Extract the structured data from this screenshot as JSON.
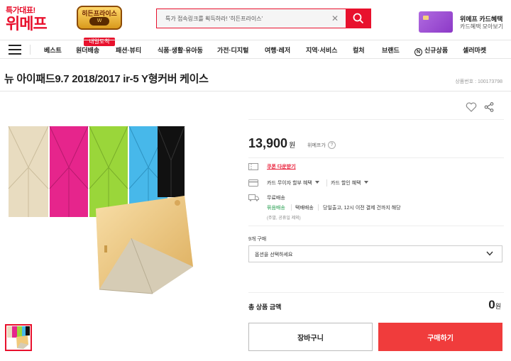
{
  "header": {
    "logo_tag": "특가대표!",
    "logo_main": "위메프",
    "promo_title": "히든프라이스",
    "promo_sub": "W",
    "promo_ribbon": "내일도착",
    "search_value": "특가 접속링크를 획득하라! '히든프라이스'",
    "card_ad_title": "위메프 카드혜택",
    "card_ad_sub": "카드혜택 모아보기"
  },
  "nav": {
    "items": [
      "베스트",
      "원더배송",
      "패션·뷰티",
      "식품·생활·유아동",
      "가전·디지털",
      "여행·레저",
      "지역·서비스",
      "컬처",
      "브랜드",
      "신규상품",
      "셀러마켓"
    ],
    "new_icon": "N"
  },
  "product": {
    "title": "뉴 아이패드9.7 2018/2017 ir-5 Y형커버 케이스",
    "code": "상품번호 : 100173798",
    "price": "13,900",
    "currency": "원",
    "price_label": "위메프가",
    "coupon": "쿠폰 다운받기",
    "benefit_installment": "카드 무이자 할부 혜택",
    "benefit_discount": "카드 할인 혜택",
    "shipping_free": "무료배송",
    "shipping_type": "묶음배송",
    "shipping_method": "택배배송",
    "shipping_note": "당일출고, 12시 이전 결제 건까지 해당",
    "shipping_note2": "(주말, 공휴일 제외)",
    "option_label": "9개 구매",
    "option_placeholder": "옵션을 선택하세요",
    "total_label": "총 상품 금액",
    "total_value": "0",
    "cart_button": "장바구니",
    "buy_button": "구매하기"
  },
  "colors": {
    "accent": "#e8112d",
    "buy_button": "#f03c3c",
    "shipping_green": "#1f9b4a",
    "case_colors": [
      "#e8dcc0",
      "#e6258c",
      "#9ad63a",
      "#47b8ea",
      "#111111"
    ]
  },
  "icons": [
    "search-icon",
    "clear-icon",
    "menu-icon",
    "heart-icon",
    "share-icon",
    "coupon-icon",
    "card-icon",
    "truck-icon",
    "chevron-down-icon",
    "help-icon"
  ]
}
